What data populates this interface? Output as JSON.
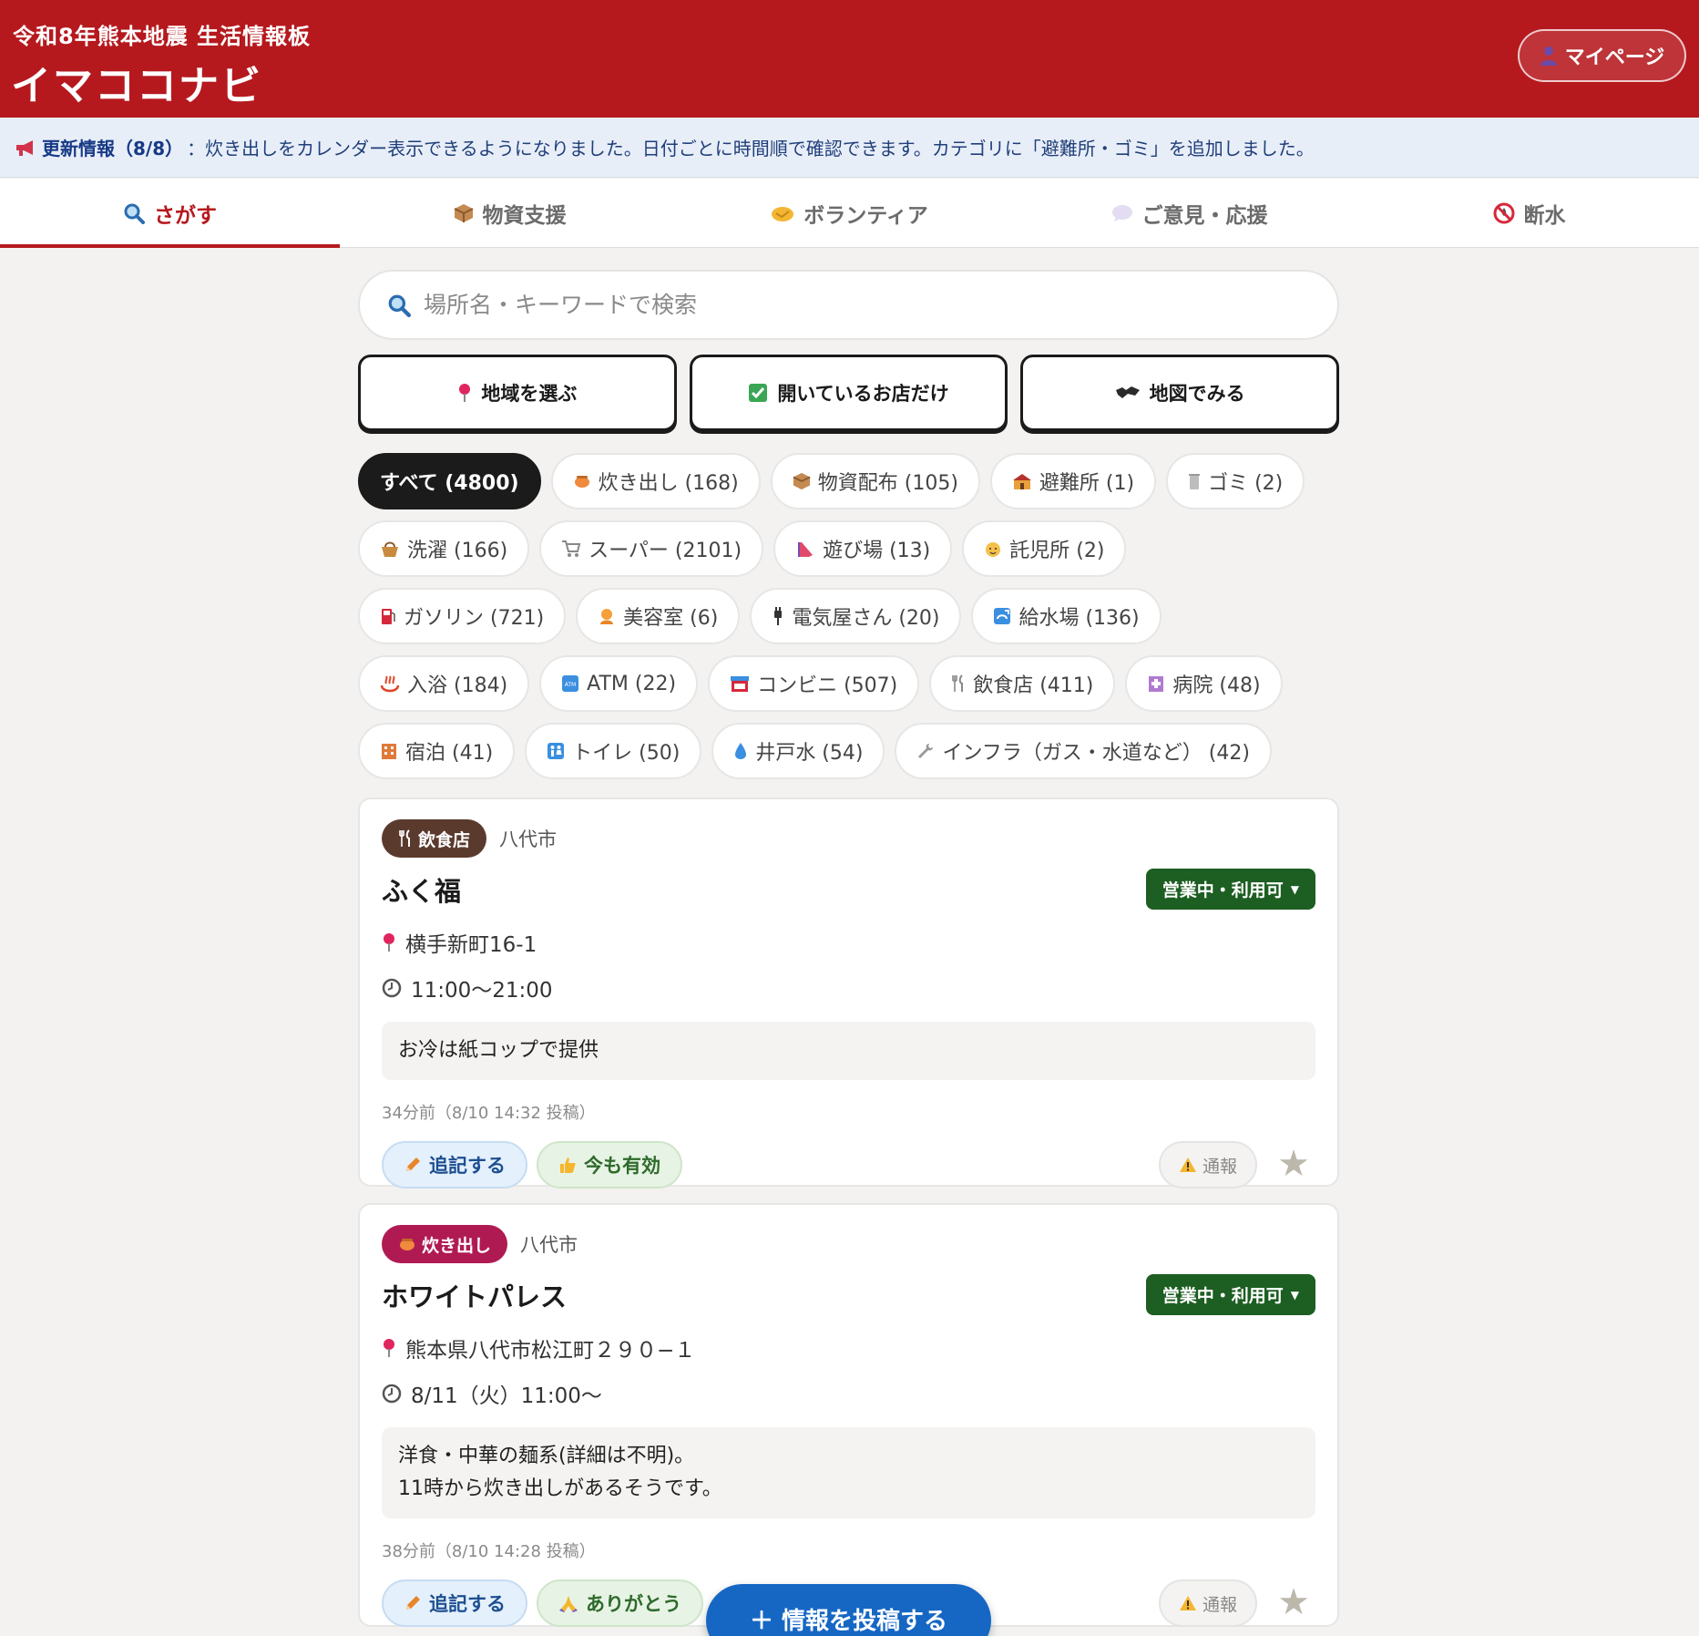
{
  "header": {
    "subtitle": "令和8年熊本地震 生活情報板",
    "title": "イマココナビ",
    "mypage_label": "マイページ",
    "mypage_icon": "person-icon"
  },
  "news": {
    "icon": "megaphone-icon",
    "lead": "更新情報（8/8）",
    "text": "：炊き出しをカレンダー表示できるようになりました。日付ごとに時間順で確認できます。カテゴリに「避難所・ゴミ」を追加しました。"
  },
  "tabs": [
    {
      "label": "さがす",
      "icon": "search-icon",
      "active": true
    },
    {
      "label": "物資支援",
      "icon": "package-icon"
    },
    {
      "label": "ボランティア",
      "icon": "handshake-icon"
    },
    {
      "label": "ご意見・応援",
      "icon": "speech-bubble-icon"
    },
    {
      "label": "断水",
      "icon": "no-water-icon"
    }
  ],
  "search": {
    "placeholder": "場所名・キーワードで検索"
  },
  "filters": [
    {
      "label": "地域を選ぶ",
      "icon": "pin-icon"
    },
    {
      "label": "開いているお店だけ",
      "icon": "checkbox-icon"
    },
    {
      "label": "地図でみる",
      "icon": "map-icon"
    }
  ],
  "categories": [
    {
      "label": "すべて (4800)",
      "active": true
    },
    {
      "label": "炊き出し (168)",
      "icon": "cooking-pot-icon"
    },
    {
      "label": "物資配布 (105)",
      "icon": "package-icon"
    },
    {
      "label": "避難所 (1)",
      "icon": "school-icon"
    },
    {
      "label": "ゴミ (2)",
      "icon": "trash-icon"
    },
    {
      "label": "洗濯 (166)",
      "icon": "basket-icon"
    },
    {
      "label": "スーパー (2101)",
      "icon": "cart-icon"
    },
    {
      "label": "遊び場 (13)",
      "icon": "slide-icon"
    },
    {
      "label": "託児所 (2)",
      "icon": "baby-icon"
    },
    {
      "label": "ガソリン (721)",
      "icon": "fuel-icon"
    },
    {
      "label": "美容室 (6)",
      "icon": "haircut-icon"
    },
    {
      "label": "電気屋さん (20)",
      "icon": "plug-icon"
    },
    {
      "label": "給水場 (136)",
      "icon": "water-tap-icon"
    },
    {
      "label": "入浴 (184)",
      "icon": "hot-spring-icon"
    },
    {
      "label": "ATM (22)",
      "icon": "atm-icon"
    },
    {
      "label": "コンビニ (507)",
      "icon": "store-icon"
    },
    {
      "label": "飲食店 (411)",
      "icon": "fork-knife-icon"
    },
    {
      "label": "病院 (48)",
      "icon": "hospital-icon"
    },
    {
      "label": "宿泊 (41)",
      "icon": "hotel-icon"
    },
    {
      "label": "トイレ (50)",
      "icon": "restroom-icon"
    },
    {
      "label": "井戸水 (54)",
      "icon": "droplet-icon"
    },
    {
      "label": "インフラ（ガス・水道など） (42)",
      "icon": "wrench-icon"
    }
  ],
  "posts": [
    {
      "category": "飲食店",
      "category_icon": "fork-knife-icon",
      "category_color": "#5b3a2e",
      "city": "八代市",
      "name": "ふく福",
      "status": "営業中・利用可",
      "address": "横手新町16-1",
      "hours": "11:00〜21:00",
      "memo": [
        "お冷は紙コップで提供"
      ],
      "meta": "34分前（8/10 14:32 投稿）",
      "edit_label": "追記する",
      "reaction_label": "今も有効",
      "reaction_icon": "thumbs-up-icon",
      "report_label": "通報"
    },
    {
      "category": "炊き出し",
      "category_icon": "cooking-pot-icon",
      "category_color": "#b01a52",
      "city": "八代市",
      "name": "ホワイトパレス",
      "status": "営業中・利用可",
      "address": "熊本県八代市松江町２９０−１",
      "hours": "8/11（火）11:00〜",
      "memo": [
        "洋食・中華の麺系(詳細は不明)。",
        "11時から炊き出しがあるそうです。"
      ],
      "meta": "38分前（8/10 14:28 投稿）",
      "edit_label": "追記する",
      "reaction_label": "ありがとう",
      "reaction_icon": "praying-hands-icon",
      "report_label": "通報"
    }
  ],
  "post_button": {
    "label": "＋ 情報を投稿する"
  },
  "colors": {
    "brand": "#b5191e",
    "status": "#1d5e22",
    "post_button": "#1667c4"
  }
}
